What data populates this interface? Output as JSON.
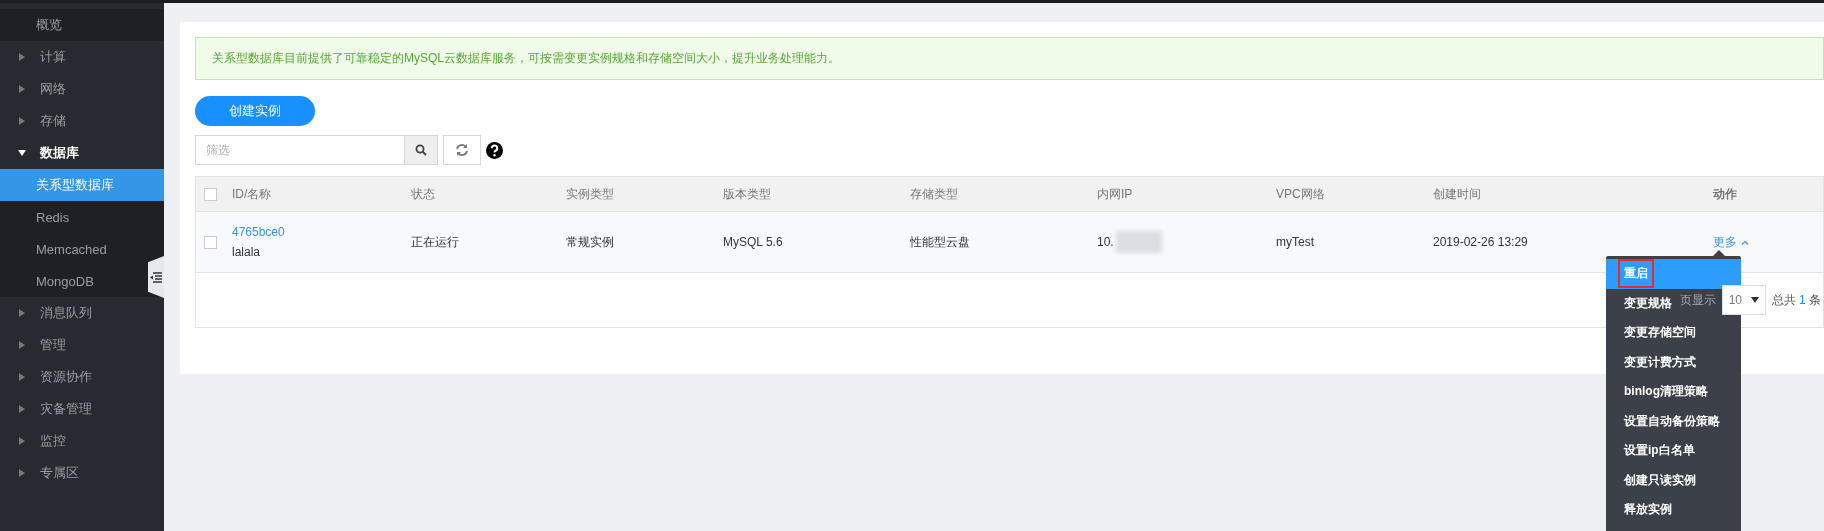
{
  "sidebar": {
    "items": [
      {
        "label": "概览",
        "kind": "link",
        "selected": false
      },
      {
        "label": "计算",
        "kind": "group",
        "expanded": false
      },
      {
        "label": "网络",
        "kind": "group",
        "expanded": false
      },
      {
        "label": "存储",
        "kind": "group",
        "expanded": false
      },
      {
        "label": "数据库",
        "kind": "group",
        "expanded": true,
        "children": [
          {
            "label": "关系型数据库",
            "selected": true
          },
          {
            "label": "Redis",
            "selected": false
          },
          {
            "label": "Memcached",
            "selected": false
          },
          {
            "label": "MongoDB",
            "selected": false
          }
        ]
      },
      {
        "label": "消息队列",
        "kind": "group",
        "expanded": false
      },
      {
        "label": "管理",
        "kind": "group",
        "expanded": false
      },
      {
        "label": "资源协作",
        "kind": "group",
        "expanded": false
      },
      {
        "label": "灾备管理",
        "kind": "group",
        "expanded": false
      },
      {
        "label": "监控",
        "kind": "group",
        "expanded": false
      },
      {
        "label": "专属区",
        "kind": "group",
        "expanded": false
      }
    ]
  },
  "notice": "关系型数据库目前提供了可靠稳定的MySQL云数据库服务，可按需变更实例规格和存储空间大小，提升业务处理能力。",
  "create_button": "创建实例",
  "filter": {
    "placeholder": "筛选"
  },
  "table": {
    "header_checked": false,
    "columns": [
      "ID/名称",
      "状态",
      "实例类型",
      "版本类型",
      "存储类型",
      "内网IP",
      "VPC网络",
      "创建时间",
      "动作"
    ],
    "rows": [
      {
        "checked": false,
        "id": "4765bce0",
        "name": "lalala",
        "status": "正在运行",
        "instance_type": "常规实例",
        "version": "MySQL 5.6",
        "storage": "性能型云盘",
        "ip": "10.",
        "vpc": "myTest",
        "created": "2019-02-26 13:29",
        "action": "更多"
      }
    ]
  },
  "pagination": {
    "per_page_label": "页显示",
    "per_page": "10",
    "total_prefix": "总共",
    "total": "1",
    "total_suffix": "条"
  },
  "action_menu": {
    "items": [
      {
        "label": "重启",
        "selected": true
      },
      {
        "label": "变更规格",
        "selected": false
      },
      {
        "label": "变更存储空间",
        "selected": false
      },
      {
        "label": "变更计费方式",
        "selected": false
      },
      {
        "label": "binlog清理策略",
        "selected": false
      },
      {
        "label": "设置自动备份策略",
        "selected": false
      },
      {
        "label": "设置ip白名单",
        "selected": false
      },
      {
        "label": "创建只读实例",
        "selected": false
      },
      {
        "label": "释放实例",
        "selected": false
      }
    ]
  }
}
